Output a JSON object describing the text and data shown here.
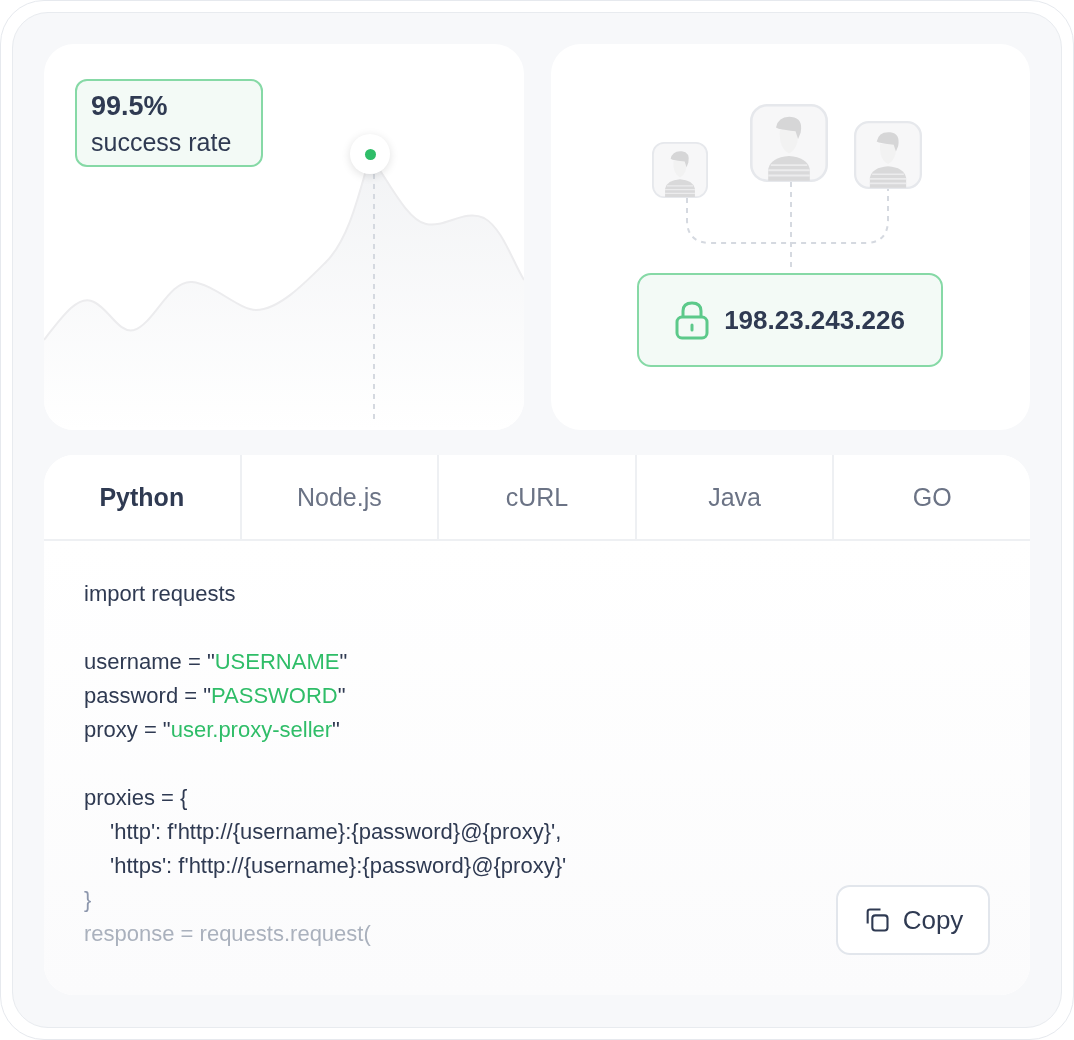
{
  "stat": {
    "value": "99.5%",
    "label": "success rate"
  },
  "ip_address": "198.23.243.226",
  "tabs": [
    {
      "label": "Python",
      "selected": true
    },
    {
      "label": "Node.js",
      "selected": false
    },
    {
      "label": "cURL",
      "selected": false
    },
    {
      "label": "Java",
      "selected": false
    },
    {
      "label": "GO",
      "selected": false
    }
  ],
  "code": {
    "lines": [
      {
        "kind": "code",
        "indented": false,
        "parts": [
          {
            "kind": "plain",
            "text": "import requests"
          }
        ]
      },
      {
        "kind": "blank"
      },
      {
        "kind": "code",
        "indented": false,
        "parts": [
          {
            "kind": "plain",
            "text": "username = \""
          },
          {
            "kind": "string",
            "text": "USERNAME"
          },
          {
            "kind": "plain",
            "text": "\""
          }
        ]
      },
      {
        "kind": "code",
        "indented": false,
        "parts": [
          {
            "kind": "plain",
            "text": "password = \""
          },
          {
            "kind": "string",
            "text": "PASSWORD"
          },
          {
            "kind": "plain",
            "text": "\""
          }
        ]
      },
      {
        "kind": "code",
        "indented": false,
        "parts": [
          {
            "kind": "plain",
            "text": "proxy = \""
          },
          {
            "kind": "string",
            "text": "user.proxy-seller"
          },
          {
            "kind": "plain",
            "text": "\""
          }
        ]
      },
      {
        "kind": "blank"
      },
      {
        "kind": "code",
        "indented": false,
        "parts": [
          {
            "kind": "plain",
            "text": "proxies = {"
          }
        ]
      },
      {
        "kind": "code",
        "indented": true,
        "parts": [
          {
            "kind": "plain",
            "text": "'http': f'http://{username}:{password}@{proxy}',"
          }
        ]
      },
      {
        "kind": "code",
        "indented": true,
        "parts": [
          {
            "kind": "plain",
            "text": "'https': f'http://{username}:{password}@{proxy}'"
          }
        ]
      },
      {
        "kind": "dim",
        "indented": false,
        "parts": [
          {
            "kind": "plain",
            "text": "}"
          }
        ]
      },
      {
        "kind": "faint",
        "indented": false,
        "parts": [
          {
            "kind": "plain",
            "text": "response = requests.request("
          }
        ]
      }
    ]
  },
  "copy_button": "Copy"
}
